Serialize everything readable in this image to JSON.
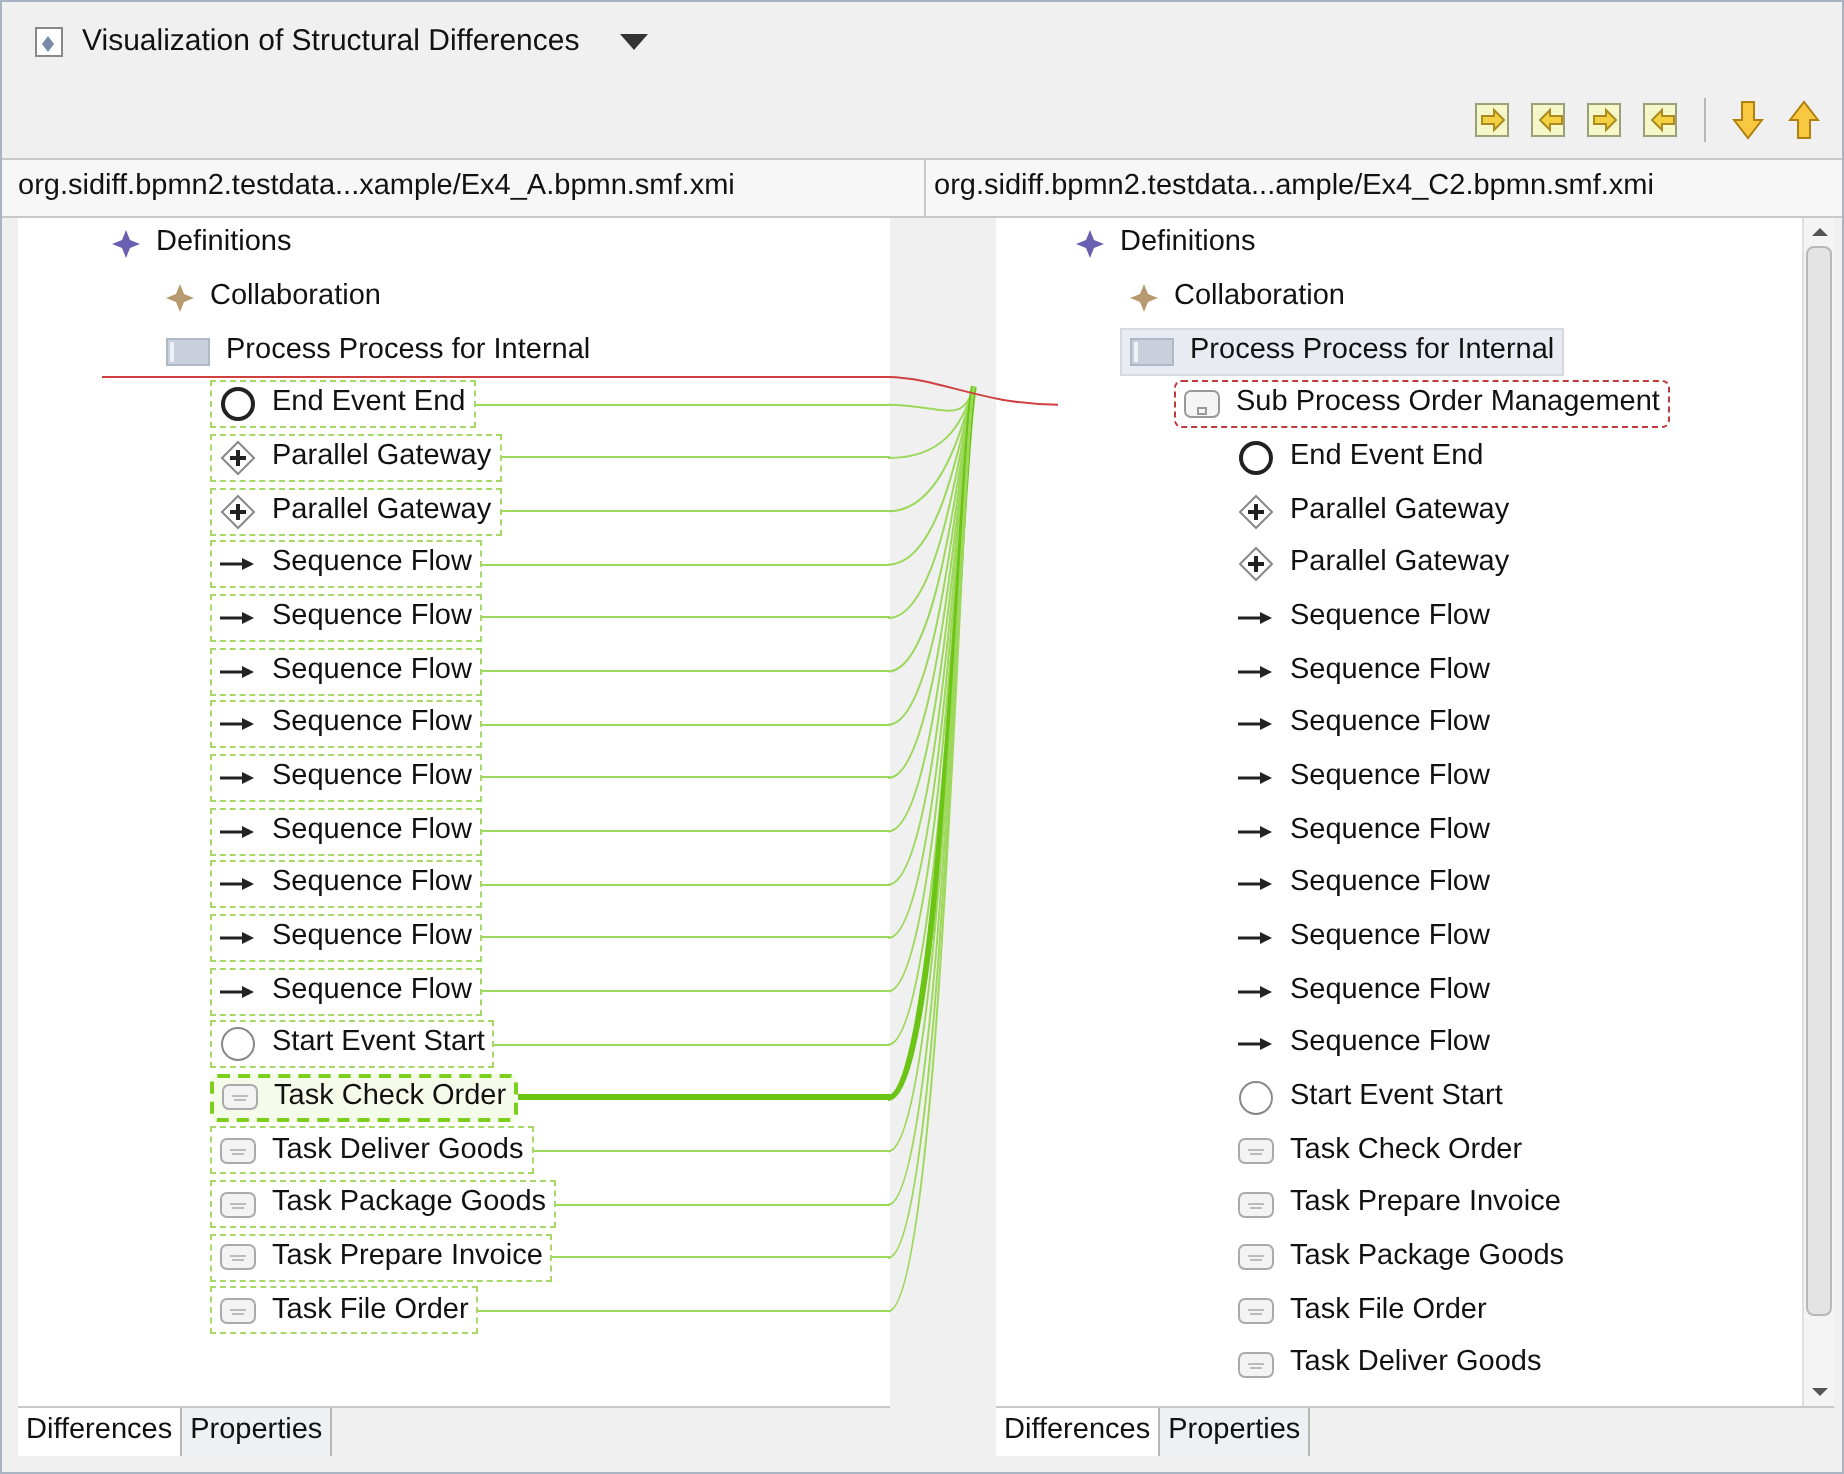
{
  "view": {
    "title": "Visualization of Structural Differences"
  },
  "left_panel": {
    "file": "org.sidiff.bpmn2.testdata...xample/Ex4_A.bpmn.smf.xmi",
    "tree": [
      {
        "kind": "definitions",
        "label": "Definitions",
        "matched": false,
        "added": false,
        "selected": false,
        "children": [
          {
            "kind": "collaboration",
            "label": "Collaboration",
            "matched": false,
            "added": false,
            "selected": false
          },
          {
            "kind": "process",
            "label": "Process Process for Internal",
            "matched": false,
            "added": false,
            "selected": false,
            "children": [
              {
                "kind": "end-event",
                "label": "End Event End",
                "matched": true,
                "added": false,
                "selected": false
              },
              {
                "kind": "gateway",
                "label": "Parallel Gateway",
                "matched": true,
                "added": false,
                "selected": false
              },
              {
                "kind": "gateway",
                "label": "Parallel Gateway",
                "matched": true,
                "added": false,
                "selected": false
              },
              {
                "kind": "sequence-flow",
                "label": "Sequence Flow",
                "matched": true,
                "added": false,
                "selected": false
              },
              {
                "kind": "sequence-flow",
                "label": "Sequence Flow",
                "matched": true,
                "added": false,
                "selected": false
              },
              {
                "kind": "sequence-flow",
                "label": "Sequence Flow",
                "matched": true,
                "added": false,
                "selected": false
              },
              {
                "kind": "sequence-flow",
                "label": "Sequence Flow",
                "matched": true,
                "added": false,
                "selected": false
              },
              {
                "kind": "sequence-flow",
                "label": "Sequence Flow",
                "matched": true,
                "added": false,
                "selected": false
              },
              {
                "kind": "sequence-flow",
                "label": "Sequence Flow",
                "matched": true,
                "added": false,
                "selected": false
              },
              {
                "kind": "sequence-flow",
                "label": "Sequence Flow",
                "matched": true,
                "added": false,
                "selected": false
              },
              {
                "kind": "sequence-flow",
                "label": "Sequence Flow",
                "matched": true,
                "added": false,
                "selected": false
              },
              {
                "kind": "sequence-flow",
                "label": "Sequence Flow",
                "matched": true,
                "added": false,
                "selected": false
              },
              {
                "kind": "start-event",
                "label": "Start Event Start",
                "matched": true,
                "added": false,
                "selected": false
              },
              {
                "kind": "task",
                "label": "Task Check Order",
                "matched": true,
                "added": false,
                "selected": true
              },
              {
                "kind": "task",
                "label": "Task Deliver Goods",
                "matched": true,
                "added": false,
                "selected": false
              },
              {
                "kind": "task",
                "label": "Task Package Goods",
                "matched": true,
                "added": false,
                "selected": false
              },
              {
                "kind": "task",
                "label": "Task Prepare Invoice",
                "matched": true,
                "added": false,
                "selected": false
              },
              {
                "kind": "task",
                "label": "Task File Order",
                "matched": true,
                "added": false,
                "selected": false
              }
            ]
          }
        ]
      }
    ],
    "tabs": [
      {
        "label": "Differences",
        "selected": true
      },
      {
        "label": "Properties",
        "selected": false
      }
    ]
  },
  "right_panel": {
    "file": "org.sidiff.bpmn2.testdata...ample/Ex4_C2.bpmn.smf.xmi",
    "tree": [
      {
        "kind": "definitions",
        "label": "Definitions",
        "matched": false,
        "added": false,
        "selected": false,
        "children": [
          {
            "kind": "collaboration",
            "label": "Collaboration",
            "matched": false,
            "added": false,
            "selected": false
          },
          {
            "kind": "process",
            "label": "Process Process for Internal",
            "matched": false,
            "added": false,
            "selected": true,
            "children": [
              {
                "kind": "subprocess",
                "label": "Sub Process Order Management",
                "matched": false,
                "added": true,
                "selected": false,
                "children": [
                  {
                    "kind": "end-event",
                    "label": "End Event End",
                    "matched": false,
                    "added": false,
                    "selected": false
                  },
                  {
                    "kind": "gateway",
                    "label": "Parallel Gateway",
                    "matched": false,
                    "added": false,
                    "selected": false
                  },
                  {
                    "kind": "gateway",
                    "label": "Parallel Gateway",
                    "matched": false,
                    "added": false,
                    "selected": false
                  },
                  {
                    "kind": "sequence-flow",
                    "label": "Sequence Flow",
                    "matched": false,
                    "added": false,
                    "selected": false
                  },
                  {
                    "kind": "sequence-flow",
                    "label": "Sequence Flow",
                    "matched": false,
                    "added": false,
                    "selected": false
                  },
                  {
                    "kind": "sequence-flow",
                    "label": "Sequence Flow",
                    "matched": false,
                    "added": false,
                    "selected": false
                  },
                  {
                    "kind": "sequence-flow",
                    "label": "Sequence Flow",
                    "matched": false,
                    "added": false,
                    "selected": false
                  },
                  {
                    "kind": "sequence-flow",
                    "label": "Sequence Flow",
                    "matched": false,
                    "added": false,
                    "selected": false
                  },
                  {
                    "kind": "sequence-flow",
                    "label": "Sequence Flow",
                    "matched": false,
                    "added": false,
                    "selected": false
                  },
                  {
                    "kind": "sequence-flow",
                    "label": "Sequence Flow",
                    "matched": false,
                    "added": false,
                    "selected": false
                  },
                  {
                    "kind": "sequence-flow",
                    "label": "Sequence Flow",
                    "matched": false,
                    "added": false,
                    "selected": false
                  },
                  {
                    "kind": "sequence-flow",
                    "label": "Sequence Flow",
                    "matched": false,
                    "added": false,
                    "selected": false
                  },
                  {
                    "kind": "start-event",
                    "label": "Start Event Start",
                    "matched": false,
                    "added": false,
                    "selected": false
                  },
                  {
                    "kind": "task",
                    "label": "Task Check Order",
                    "matched": false,
                    "added": false,
                    "selected": false
                  },
                  {
                    "kind": "task",
                    "label": "Task Prepare Invoice",
                    "matched": false,
                    "added": false,
                    "selected": false
                  },
                  {
                    "kind": "task",
                    "label": "Task Package Goods",
                    "matched": false,
                    "added": false,
                    "selected": false
                  },
                  {
                    "kind": "task",
                    "label": "Task File Order",
                    "matched": false,
                    "added": false,
                    "selected": false
                  },
                  {
                    "kind": "task",
                    "label": "Task Deliver Goods",
                    "matched": false,
                    "added": false,
                    "selected": false
                  }
                ]
              }
            ]
          }
        ]
      }
    ],
    "tabs": [
      {
        "label": "Differences",
        "selected": true
      },
      {
        "label": "Properties",
        "selected": false
      }
    ]
  }
}
